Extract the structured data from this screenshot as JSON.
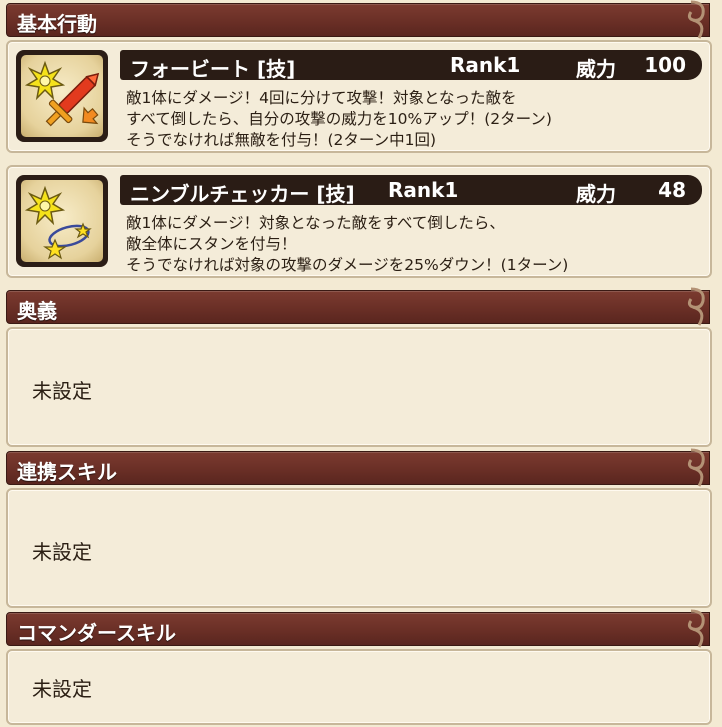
{
  "sections": {
    "basic_actions": {
      "title": "基本行動"
    },
    "ougi": {
      "title": "奥義",
      "value": "未設定"
    },
    "link_skill": {
      "title": "連携スキル",
      "value": "未設定"
    },
    "commander_skill": {
      "title": "コマンダースキル",
      "value": "未設定"
    }
  },
  "skills": [
    {
      "name": "フォービート [技]",
      "rank": "Rank1",
      "power_label": "威力",
      "power_value": "100",
      "icon": "sword-burst-icon",
      "description": [
        "敵1体にダメージ！4回に分けて攻撃！対象となった敵を",
        "すべて倒したら、自分の攻撃の威力を10%アップ！(2ターン)",
        "そうでなければ無敵を付与！(2ターン中1回)"
      ]
    },
    {
      "name": "ニンブルチェッカー [技]",
      "rank": "Rank1",
      "power_label": "威力",
      "power_value": "48",
      "icon": "stun-stars-icon",
      "description": [
        "敵1体にダメージ！対象となった敵をすべて倒したら、",
        "敵全体にスタンを付与！",
        "そうでなければ対象の攻撃のダメージを25%ダウン！(1ターン)"
      ]
    }
  ],
  "colors": {
    "header_bar": "#6a2f26",
    "title_bar": "#2a1c15",
    "panel_bg": "#f4ecd9",
    "page_bg": "#f3ead3"
  }
}
